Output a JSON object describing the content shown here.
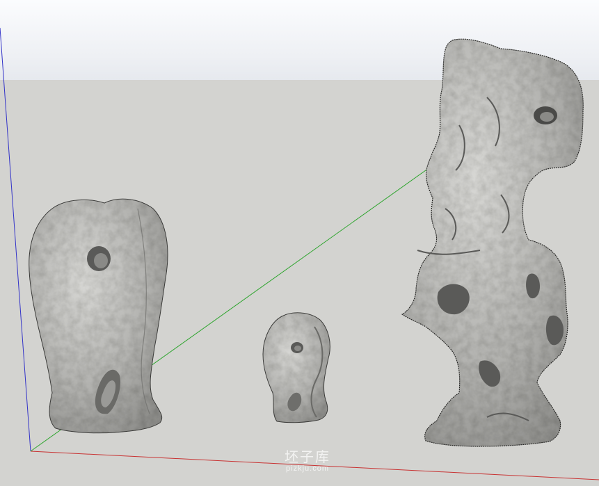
{
  "scene": {
    "background": {
      "sky_color": "#eef0f4",
      "ground_color": "#d3d3d0"
    },
    "axes": {
      "red_axis_color": "#c83232",
      "green_axis_color": "#2fa52f",
      "blue_axis_color": "#3232c8"
    },
    "objects": [
      {
        "name": "rock-large-left",
        "color": "#b9b9b6"
      },
      {
        "name": "rock-small-center",
        "color": "#b9b9b6"
      },
      {
        "name": "rock-tall-right",
        "color": "#b9b9b6"
      }
    ]
  },
  "watermark": {
    "text_cn": "坯子库",
    "text_url": "pizkju.com"
  }
}
